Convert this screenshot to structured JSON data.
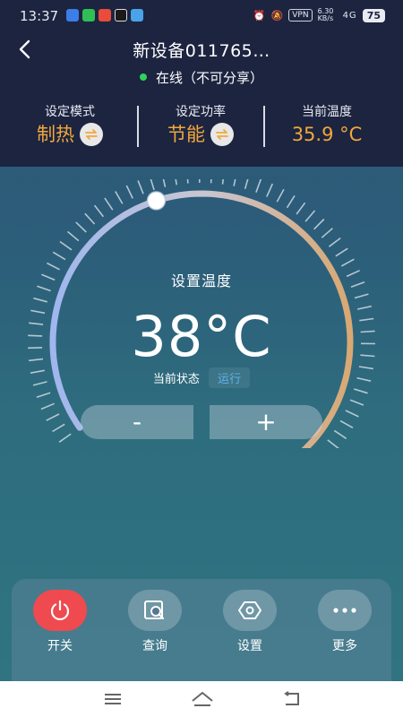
{
  "status_bar": {
    "time": "13:37",
    "vpn": "VPN",
    "net_speed": "6.30 KB/s",
    "signal": "4G",
    "battery": "75"
  },
  "header": {
    "title": "新设备011765…",
    "online_status": "在线（不可分享）"
  },
  "stats": [
    {
      "label": "设定模式",
      "value": "制热"
    },
    {
      "label": "设定功率",
      "value": "节能"
    },
    {
      "label": "当前温度",
      "value": "35.9 °C"
    }
  ],
  "dial": {
    "set_label": "设置温度",
    "set_temperature": "38°C",
    "state_label": "当前状态",
    "state_value": "运行",
    "slider_fraction": 0.37
  },
  "stepper": {
    "minus": "-",
    "plus": "+"
  },
  "actions": [
    {
      "label": "开关",
      "icon": "power-icon"
    },
    {
      "label": "查询",
      "icon": "query-icon"
    },
    {
      "label": "设置",
      "icon": "settings-icon"
    },
    {
      "label": "更多",
      "icon": "more-icon"
    }
  ],
  "colors": {
    "accent_orange": "#f2a73b",
    "online_green": "#2fd15c",
    "power_red": "#ef4a4f",
    "running_blue": "#5fb4e8"
  }
}
